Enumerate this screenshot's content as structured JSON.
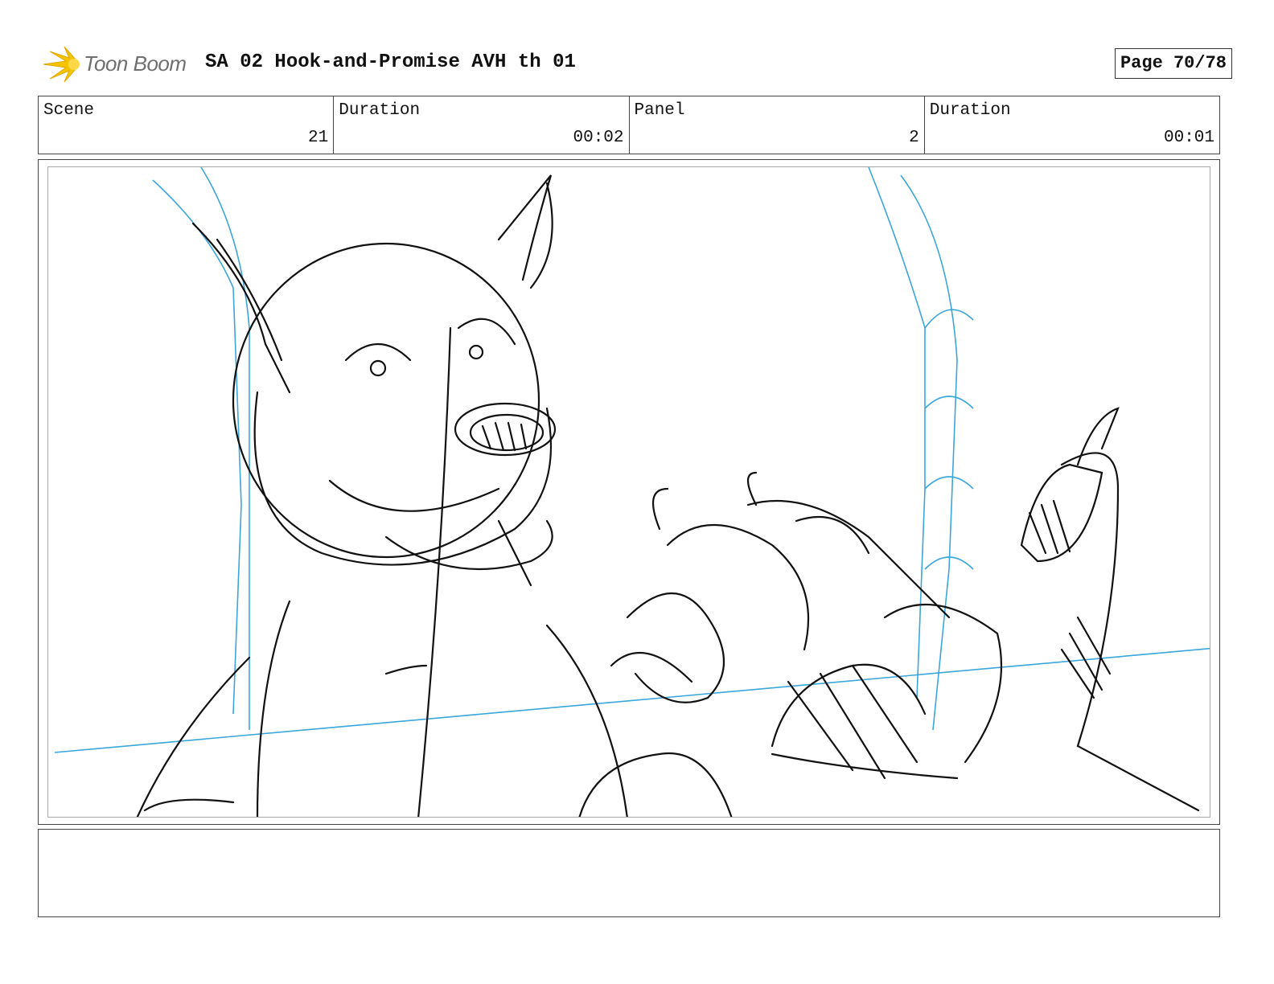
{
  "header": {
    "logo_text": "Toon Boom",
    "title": "SA 02 Hook-and-Promise AVH th 01",
    "page": "Page 70/78"
  },
  "info": [
    {
      "label": "Scene",
      "value": "21"
    },
    {
      "label": "Duration",
      "value": "00:02"
    },
    {
      "label": "Panel",
      "value": "2"
    },
    {
      "label": "Duration",
      "value": "00:01"
    }
  ],
  "panel": {
    "description": "",
    "sketch_colors": {
      "ink": "#111111",
      "guide": "#3aa6dc"
    }
  },
  "notes": {
    "text": ""
  },
  "colors": {
    "logo_flame": "#f5c400",
    "border": "#444444"
  }
}
